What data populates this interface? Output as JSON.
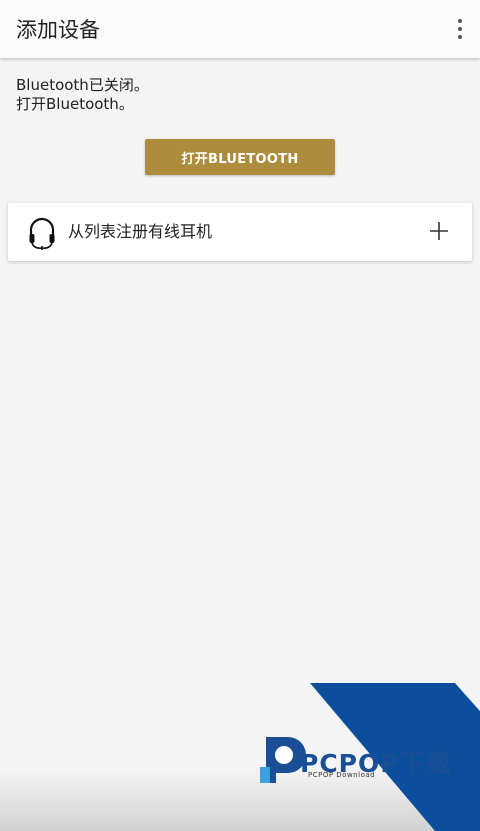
{
  "appbar": {
    "title": "添加设备",
    "overflow_icon": "more-vert-icon"
  },
  "status": {
    "line1": "Bluetooth已关闭。",
    "line2": "打开Bluetooth。"
  },
  "bluetooth_button": {
    "label": "打开BLUETOOTH",
    "color": "#ad8d3d"
  },
  "wired_card": {
    "icon": "headphone-icon",
    "label": "从列表注册有线耳机",
    "action_icon": "plus-icon"
  },
  "watermark": {
    "brand": "PCPOP下载",
    "sub": "PCPOP Download",
    "color": "#0b4f9c"
  }
}
